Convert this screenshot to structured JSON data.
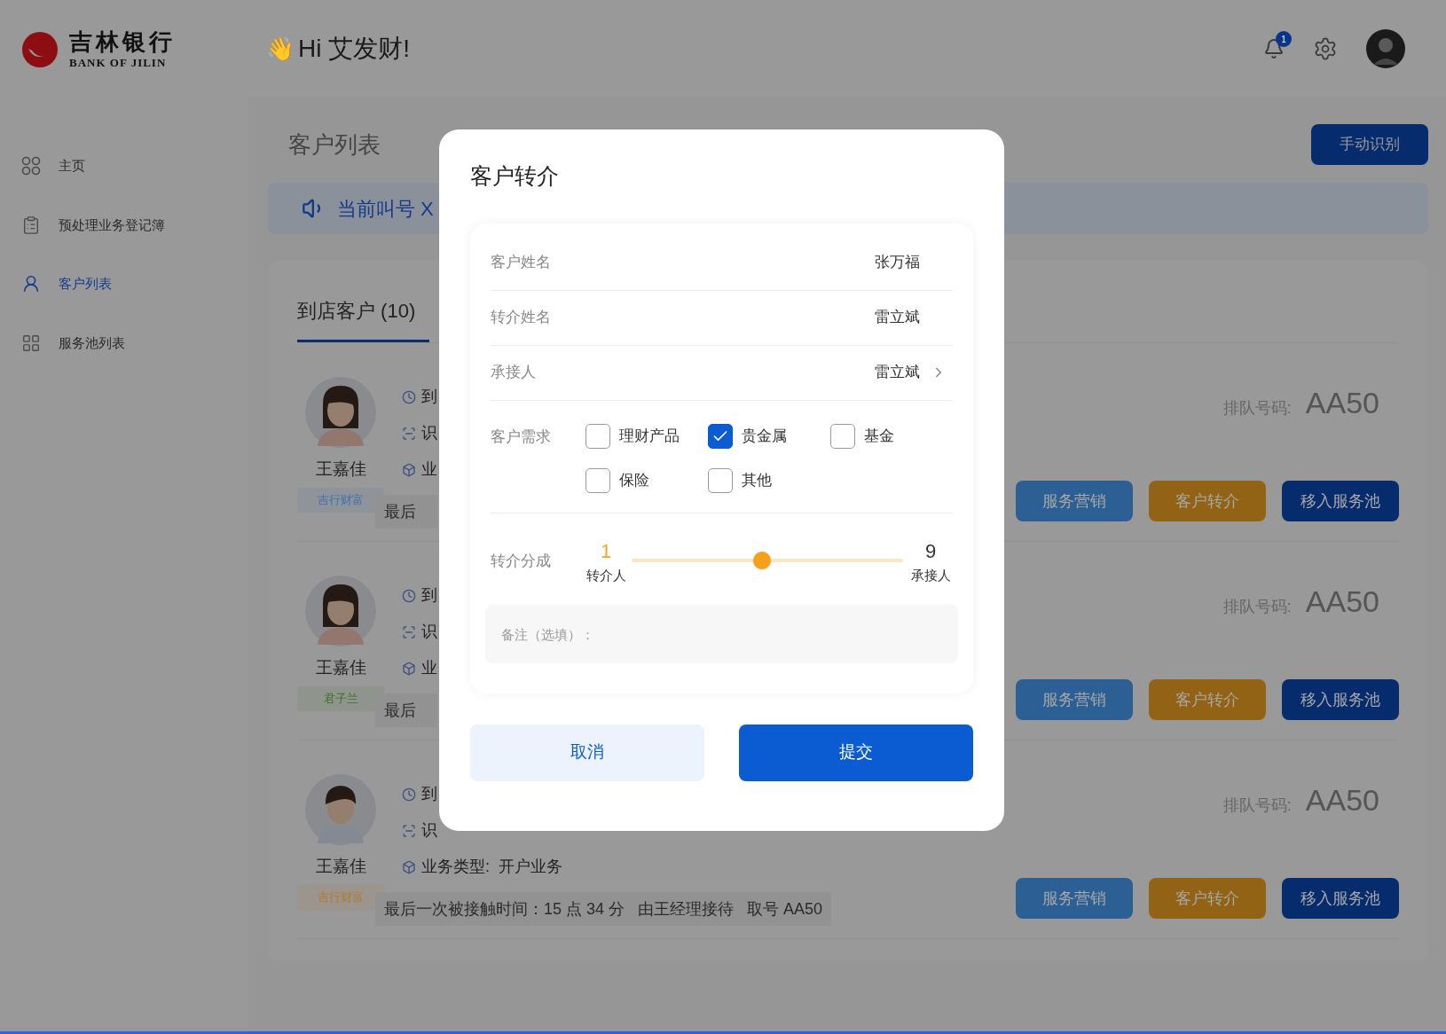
{
  "logo": {
    "name": "吉林银行",
    "name_en": "BANK OF JILIN"
  },
  "greeting": {
    "emoji": "👋",
    "text": "Hi 艾发财!"
  },
  "notifications": {
    "badge": "1"
  },
  "sidebar": {
    "items": [
      {
        "label": "主页",
        "selected": false
      },
      {
        "label": "预处理业务登记簿",
        "selected": false
      },
      {
        "label": "客户列表",
        "selected": true
      },
      {
        "label": "服务池列表",
        "selected": false
      }
    ]
  },
  "page": {
    "title": "客户列表",
    "action": "手动识别",
    "notice": "当前叫号 X"
  },
  "tabs": [
    {
      "label": "到店客户 (10)",
      "selected": true
    }
  ],
  "customers": [
    {
      "name": "王嘉佳",
      "kind": "long-hair",
      "tag": "吉行财富",
      "color": "#3a6fb0",
      "info": [
        "到",
        "识",
        "业"
      ],
      "last_contact": "最后",
      "queue_label": "排队号码:",
      "queue_number": "AA50",
      "buttons": [
        {
          "label": "服务营销",
          "kind": "service"
        },
        {
          "label": "客户转介",
          "kind": "referral"
        },
        {
          "label": "移入服务池",
          "kind": "pool"
        }
      ]
    },
    {
      "name": "王嘉佳",
      "kind": "long-hair",
      "tag": "君子兰",
      "color": "#3b7326",
      "info": [
        "到",
        "识",
        "业"
      ],
      "last_contact": "最后",
      "queue_label": "排队号码:",
      "queue_number": "AA50",
      "buttons": [
        {
          "label": "服务营销",
          "kind": "service"
        },
        {
          "label": "客户转介",
          "kind": "referral"
        },
        {
          "label": "移入服务池",
          "kind": "pool"
        }
      ]
    },
    {
      "name": "王嘉佳",
      "kind": "short-hair",
      "tag": "吉行财富",
      "color": "#b07a30",
      "info": [
        "到",
        "识",
        "业务类型:  开户业务"
      ],
      "last_contact": "最后一次被接触时间：15 点 34 分   由王经理接待   取号 AA50",
      "queue_label": "排队号码:",
      "queue_number": "AA50",
      "buttons": [
        {
          "label": "服务营销",
          "kind": "service"
        },
        {
          "label": "客户转介",
          "kind": "referral"
        },
        {
          "label": "移入服务池",
          "kind": "pool"
        }
      ]
    }
  ],
  "dialog": {
    "title": "客户转介",
    "fields": [
      {
        "label": "客户姓名",
        "value": "张万福",
        "kind": "text"
      },
      {
        "label": "转介姓名",
        "value": "雷立斌",
        "kind": "text"
      },
      {
        "label": "承接人",
        "value": "雷立斌",
        "kind": "picker"
      }
    ],
    "needs": {
      "label": "客户需求",
      "options": [
        {
          "label": "理财产品",
          "checked": false
        },
        {
          "label": "贵金属",
          "checked": true
        },
        {
          "label": "基金",
          "checked": false
        },
        {
          "label": "保险",
          "checked": false
        },
        {
          "label": "其他",
          "checked": false
        }
      ]
    },
    "split": {
      "label": "转介分成",
      "left_value": "1",
      "left_label": "转介人",
      "right_value": "9",
      "right_label": "承接人",
      "level": 0.48
    },
    "remark": {
      "placeholder": "备注（选填）："
    },
    "buttons": [
      {
        "label": "取消",
        "kind": "secondary"
      },
      {
        "label": "提交",
        "kind": "primary"
      }
    ]
  }
}
